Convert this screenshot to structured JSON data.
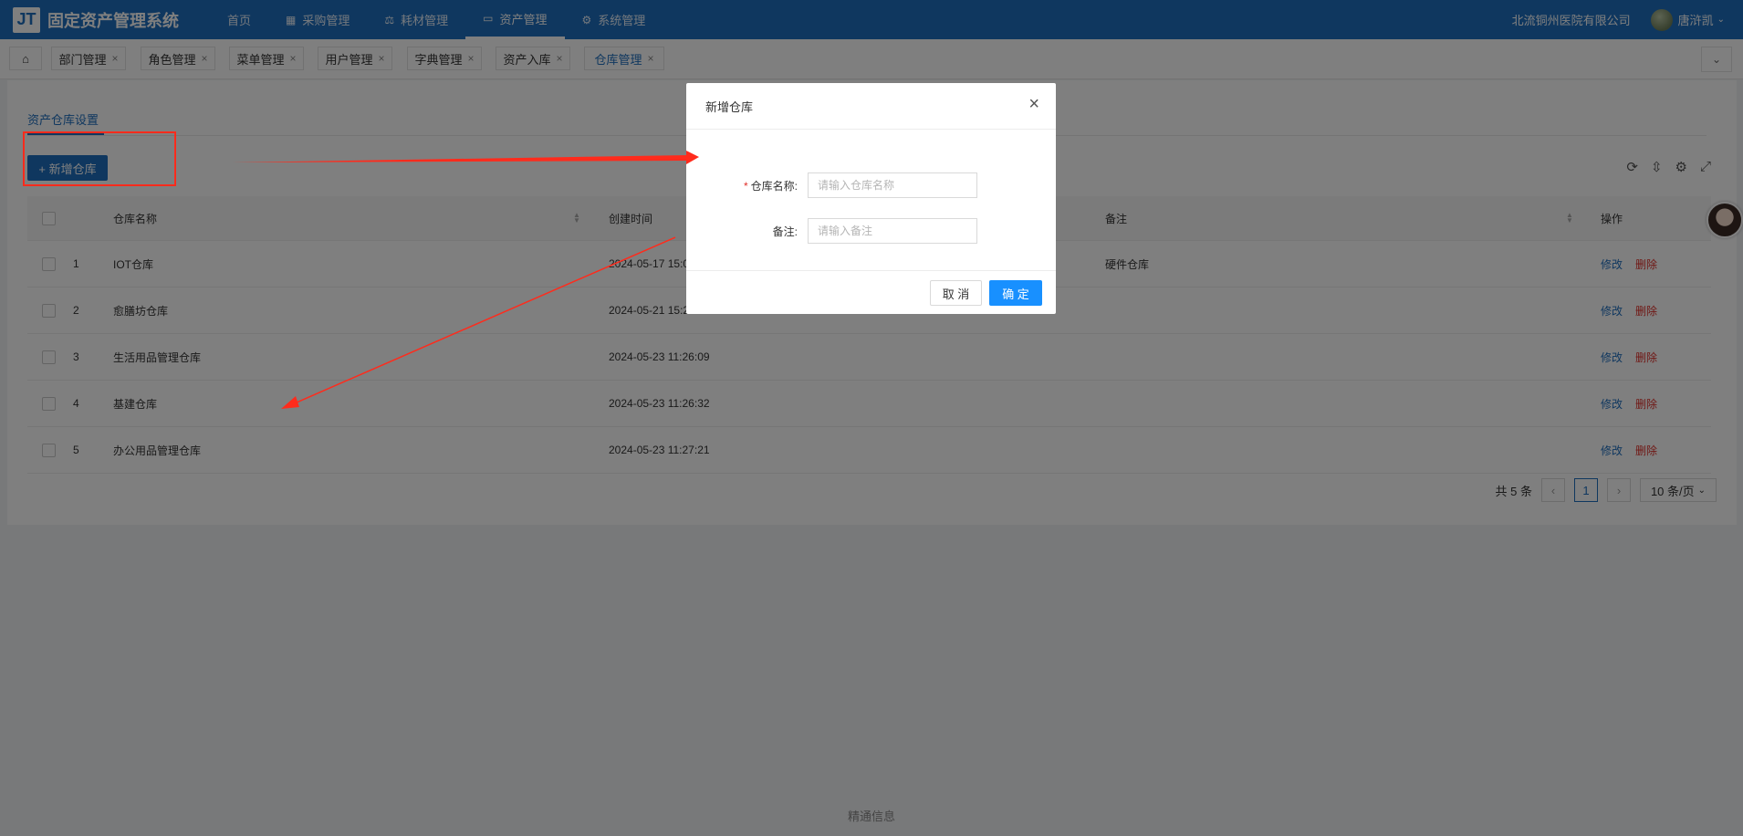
{
  "header": {
    "logo_text": "JT",
    "app_title": "固定资产管理系统",
    "nav": [
      {
        "label": "首页",
        "icon": ""
      },
      {
        "label": "采购管理",
        "icon": "grid-icon"
      },
      {
        "label": "耗材管理",
        "icon": "scale-icon"
      },
      {
        "label": "资产管理",
        "icon": "calendar-icon"
      },
      {
        "label": "系统管理",
        "icon": "gear-icon"
      }
    ],
    "company": "北流铜州医院有限公司",
    "user_name": "唐浒凯"
  },
  "tabs": [
    {
      "label": "部门管理"
    },
    {
      "label": "角色管理"
    },
    {
      "label": "菜单管理"
    },
    {
      "label": "用户管理"
    },
    {
      "label": "字典管理"
    },
    {
      "label": "资产入库"
    },
    {
      "label": "仓库管理"
    }
  ],
  "page": {
    "subtab": "资产仓库设置",
    "add_button": "+ 新增仓库"
  },
  "table": {
    "headers": {
      "name": "仓库名称",
      "time": "创建时间",
      "note": "备注",
      "ops": "操作"
    },
    "rows": [
      {
        "no": "1",
        "name": "IOT仓库",
        "time": "2024-05-17 15:0",
        "note": "硬件仓库"
      },
      {
        "no": "2",
        "name": "愈膳坊仓库",
        "time": "2024-05-21 15:2",
        "note": ""
      },
      {
        "no": "3",
        "name": "生活用品管理仓库",
        "time": "2024-05-23 11:26:09",
        "note": ""
      },
      {
        "no": "4",
        "name": "基建仓库",
        "time": "2024-05-23 11:26:32",
        "note": ""
      },
      {
        "no": "5",
        "name": "办公用品管理仓库",
        "time": "2024-05-23 11:27:21",
        "note": ""
      }
    ],
    "edit_label": "修改",
    "delete_label": "删除"
  },
  "pagination": {
    "total_text": "共 5 条",
    "current_page": "1",
    "page_size": "10 条/页"
  },
  "footer": "精通信息",
  "modal": {
    "title": "新增仓库",
    "name_label": "仓库名称:",
    "name_placeholder": "请输入仓库名称",
    "note_label": "备注:",
    "note_placeholder": "请输入备注",
    "cancel": "取 消",
    "ok": "确 定"
  },
  "colors": {
    "primary": "#1f6fbf",
    "danger": "#e0302a",
    "annotation": "#ff2b1c"
  }
}
